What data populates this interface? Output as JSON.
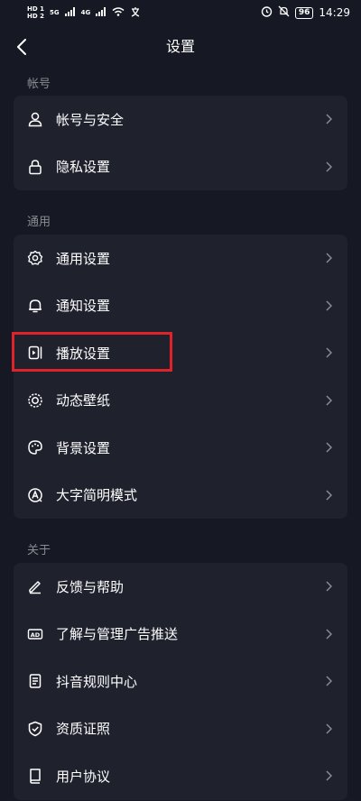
{
  "status_bar": {
    "hd_top": "HD 1",
    "hd_bottom": "HD 2",
    "net1": "5G",
    "net2": "4G",
    "battery": "96",
    "time": "14:29"
  },
  "header": {
    "title": "设置"
  },
  "sections": [
    {
      "title": "帐号",
      "items": [
        {
          "label": "帐号与安全",
          "icon": "user-icon"
        },
        {
          "label": "隐私设置",
          "icon": "lock-icon"
        }
      ]
    },
    {
      "title": "通用",
      "items": [
        {
          "label": "通用设置",
          "icon": "gear-icon"
        },
        {
          "label": "通知设置",
          "icon": "bell-icon"
        },
        {
          "label": "播放设置",
          "icon": "play-settings-icon"
        },
        {
          "label": "动态壁纸",
          "icon": "live-wallpaper-icon"
        },
        {
          "label": "背景设置",
          "icon": "palette-icon"
        },
        {
          "label": "大字简明模式",
          "icon": "large-text-icon"
        }
      ]
    },
    {
      "title": "关于",
      "items": [
        {
          "label": "反馈与帮助",
          "icon": "pen-icon"
        },
        {
          "label": "了解与管理广告推送",
          "icon": "ad-icon"
        },
        {
          "label": "抖音规则中心",
          "icon": "document-icon"
        },
        {
          "label": "资质证照",
          "icon": "shield-check-icon"
        },
        {
          "label": "用户协议",
          "icon": "book-icon"
        }
      ]
    }
  ],
  "colors": {
    "background": "#161823",
    "card": "#1f212d",
    "section_title": "#8a8b91",
    "highlight": "#e0232b"
  }
}
